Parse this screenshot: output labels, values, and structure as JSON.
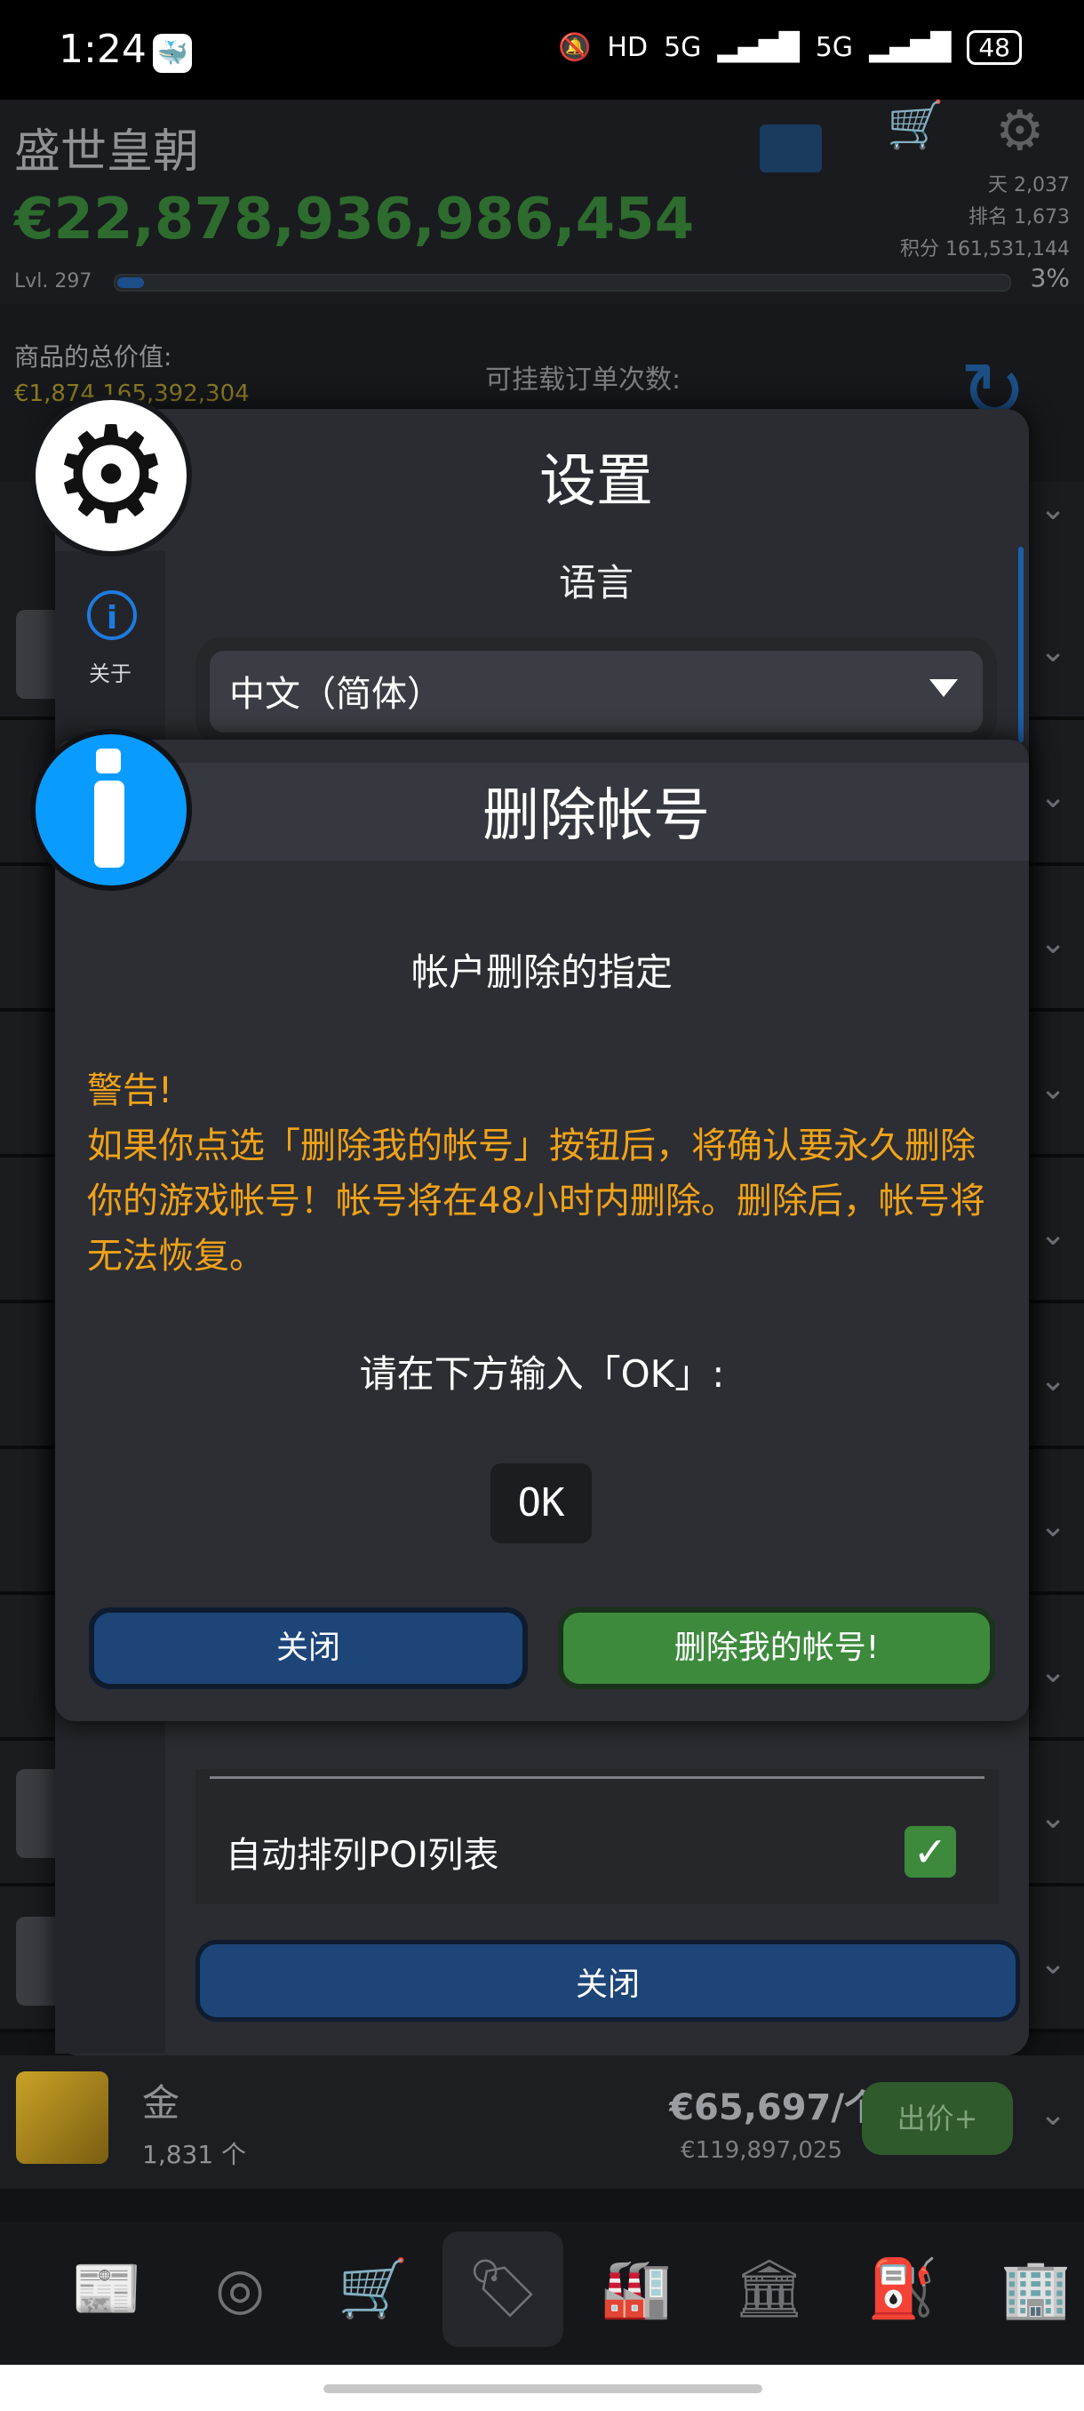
{
  "status_bar": {
    "time": "1:24",
    "network": "5G",
    "network2": "5G",
    "battery": "48",
    "hd_label": "HD"
  },
  "header": {
    "empire_name": "盛世皇朝",
    "balance": "€22,878,936,986,454",
    "days": "天 2,037",
    "rank": "排名 1,673",
    "points": "积分 161,531,144",
    "level": "Lvl. 297",
    "level_progress_pct": 3,
    "level_progress_text": "3%"
  },
  "trade_strip": {
    "goods_value_label": "商品的总价值:",
    "goods_value": "€1,874,165,392,304",
    "orders_label": "可挂载订单次数:"
  },
  "settings_dialog": {
    "title": "设置",
    "about_label": "关于",
    "language_label": "语言",
    "language_value": "中文（简体）",
    "poi_label": "自动排列POI列表",
    "poi_checked": true,
    "close_label": "关闭"
  },
  "delete_dialog": {
    "title": "删除帐号",
    "subtitle": "帐户删除的指定",
    "warning_title": "警告!",
    "warning_text": "如果你点选「删除我的帐号」按钮后，将确认要永久删除你的游戏帐号！帐号将在48小时内删除。删除后，帐号将无法恢复。",
    "instruction": "请在下方输入「OK」:",
    "input_value": "OK",
    "close_label": "关闭",
    "delete_label": "删除我的帐号!"
  },
  "gold_item": {
    "name": "金",
    "quantity": "1,831 个",
    "price": "€65,697/个",
    "total": "€119,897,025",
    "bid_label": "出价+"
  },
  "nav": {
    "news_label": "NEWS",
    "trade_label": "TRADE"
  },
  "colors": {
    "accent_blue": "#1d4578",
    "accent_green": "#3d8a3d",
    "warning": "#f0a21a",
    "info_blue": "#0a9bff"
  }
}
